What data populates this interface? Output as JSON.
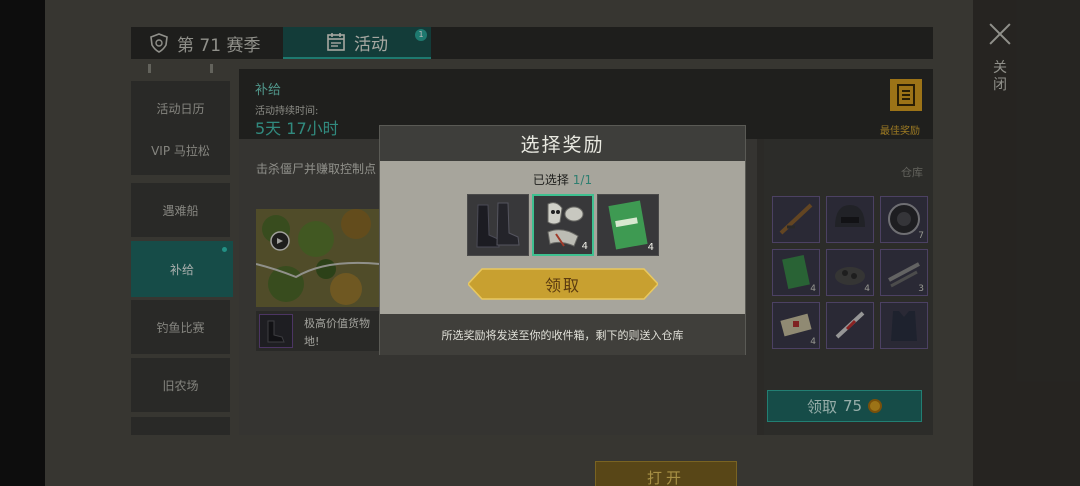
{
  "tabs": {
    "season": "第 71 赛季",
    "activity": "活动",
    "activity_badge": "1"
  },
  "nav": {
    "items": [
      {
        "label": "活动日历"
      },
      {
        "label": "VIP 马拉松"
      },
      {
        "label": "遇难船"
      },
      {
        "label": "补给"
      },
      {
        "label": "钓鱼比赛"
      },
      {
        "label": "旧农场"
      }
    ]
  },
  "header": {
    "title": "补给",
    "duration_label": "活动持续时间:",
    "duration_value": "5天 17小时",
    "best_reward": "最佳奖励"
  },
  "main": {
    "description": "击杀僵尸并赚取控制点",
    "reward_text": "极高价值货物 地!",
    "open_button": "打开"
  },
  "storage": {
    "label": "仓库",
    "slots": [
      {
        "icon": "rifle-icon",
        "count": ""
      },
      {
        "icon": "helmet-icon",
        "count": ""
      },
      {
        "icon": "lens-icon",
        "count": "7"
      },
      {
        "icon": "notebook-icon",
        "count": "4"
      },
      {
        "icon": "gravel-icon",
        "count": "4"
      },
      {
        "icon": "pipe-icon",
        "count": "3"
      },
      {
        "icon": "medkit-icon",
        "count": "4"
      },
      {
        "icon": "syringe-icon",
        "count": ""
      },
      {
        "icon": "vest-icon",
        "count": ""
      }
    ],
    "claim_label": "领取",
    "claim_cost": "75"
  },
  "close_label": "关闭",
  "modal": {
    "title": "选择奖励",
    "selected_label": "已选择",
    "selected_value": "1/1",
    "items": [
      {
        "icon": "boots-icon",
        "count": ""
      },
      {
        "icon": "zombie-parts-icon",
        "count": "4"
      },
      {
        "icon": "notebook-icon",
        "count": "4"
      }
    ],
    "claim_button": "领取",
    "note": "所选奖励将发送至你的收件箱，剩下的则送入仓库"
  },
  "colors": {
    "accent_teal": "#1f6a64",
    "gold": "#d8a020",
    "selected_border": "#3ec090"
  }
}
